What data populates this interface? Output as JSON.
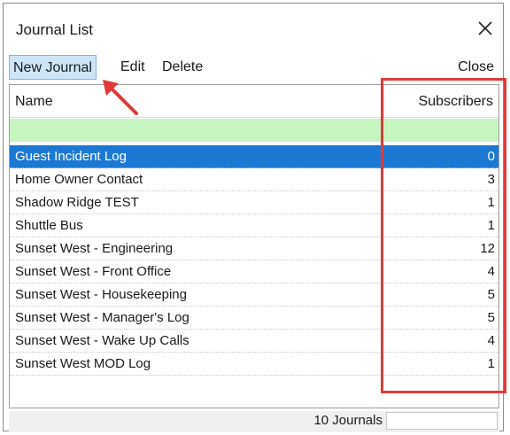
{
  "window": {
    "title": "Journal List"
  },
  "menu": {
    "new_journal": "New Journal",
    "edit": "Edit",
    "delete": "Delete",
    "close": "Close"
  },
  "list": {
    "columns": {
      "name": "Name",
      "subscribers": "Subscribers"
    },
    "rows": [
      {
        "name": "Guest Incident Log",
        "subscribers": "0"
      },
      {
        "name": "Home Owner Contact",
        "subscribers": "3"
      },
      {
        "name": "Shadow Ridge TEST",
        "subscribers": "1"
      },
      {
        "name": "Shuttle Bus",
        "subscribers": "1"
      },
      {
        "name": "Sunset West - Engineering",
        "subscribers": "12"
      },
      {
        "name": "Sunset West - Front Office",
        "subscribers": "4"
      },
      {
        "name": "Sunset West - Housekeeping",
        "subscribers": "5"
      },
      {
        "name": "Sunset West - Manager's Log",
        "subscribers": "5"
      },
      {
        "name": "Sunset West - Wake Up Calls",
        "subscribers": "4"
      },
      {
        "name": "Sunset West MOD Log",
        "subscribers": "1"
      }
    ],
    "selected_index": 0
  },
  "footer": {
    "count_label": "10 Journals"
  },
  "colors": {
    "selection": "#1b78d3",
    "filter_row": "#c7f5c0",
    "annotation": "#e03b3b",
    "menu_highlight": "#cde6f7"
  },
  "icons": {
    "close": "close-icon",
    "annotation_arrow": "arrow-icon"
  }
}
